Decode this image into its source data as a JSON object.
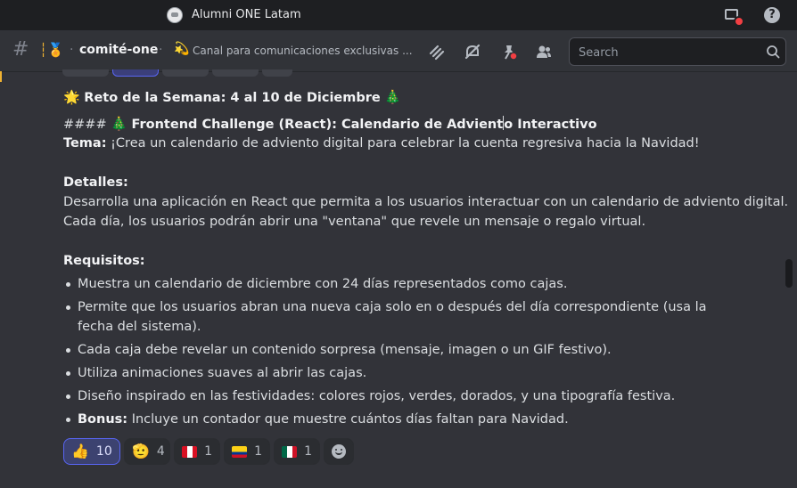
{
  "window": {
    "title": "Alumni ONE Latam"
  },
  "channel": {
    "emoji": "┆🏅",
    "name": "comité-one",
    "separator": "·",
    "topic_emoji": "💫",
    "topic": "Canal para comunicaciones exclusivas ..."
  },
  "search": {
    "placeholder": "Search"
  },
  "message": {
    "heading_emoji_left": "🌟",
    "heading": "Reto de la Semana: 4 al 10 de Diciembre",
    "heading_emoji_right": "🎄",
    "subheading_prefix": "#### ",
    "subheading_emoji": "🎄",
    "subheading_part1": "Frontend Challenge (React): Calendario de Advient",
    "subheading_part2": "o Interactivo",
    "tema_label": "Tema:",
    "tema_text": " ¡Crea un calendario de adviento digital para celebrar la cuenta regresiva hacia la Navidad!",
    "detalles_label": "Detalles:",
    "detalles_line1": "Desarrolla una aplicación en React que permita a los usuarios interactuar con un calendario de adviento digital.",
    "detalles_line2": "Cada día, los usuarios podrán abrir una \"ventana\" que revele un mensaje o regalo virtual.",
    "requisitos_label": "Requisitos:",
    "requisitos": [
      "Muestra un calendario de diciembre con 24 días representados como cajas.",
      "Permite que los usuarios abran una nueva caja solo en o después del día correspondiente (usa la fecha del sistema).",
      "Cada caja debe revelar un contenido sorpresa (mensaje, imagen o un GIF festivo).",
      "Utiliza animaciones suaves al abrir las cajas.",
      "Diseño inspirado en las festividades: colores rojos, verdes, dorados, y una tipografía festiva."
    ],
    "bonus_label": "Bonus:",
    "bonus_text": " Incluye un contador que muestre cuántos días faltan para Navidad."
  },
  "reactions": [
    {
      "emoji": "👍",
      "count": "10",
      "selected": true
    },
    {
      "emoji": "🫡",
      "count": "4",
      "selected": false
    },
    {
      "emoji": "flag-peru",
      "count": "1",
      "selected": false
    },
    {
      "emoji": "flag-colombia",
      "count": "1",
      "selected": false
    },
    {
      "emoji": "flag-mexico",
      "count": "1",
      "selected": false
    }
  ],
  "colors": {
    "accent": "#5865f2",
    "background": "#323339",
    "titlebar": "#1e1f22",
    "notification": "#f23f43"
  }
}
